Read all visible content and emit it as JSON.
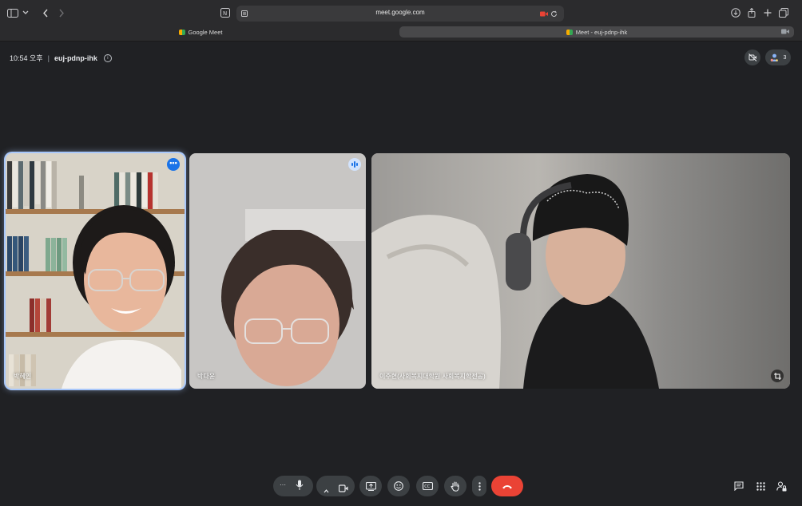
{
  "browser": {
    "url": "meet.google.com",
    "tabs": [
      {
        "label": "Google Meet",
        "active": false
      },
      {
        "label": "Meet - euj-pdnp-ihk",
        "active": true
      }
    ]
  },
  "meeting": {
    "time": "10:54 오후",
    "separator": "|",
    "code": "euj-pdnp-ihk",
    "participant_count": "3"
  },
  "participants": [
    {
      "name": "박혜인",
      "state": "pinned-highlight"
    },
    {
      "name": "박다윤",
      "state": "speaking"
    },
    {
      "name": "이주현(사회복지대학원 사회복지학전공)",
      "state": "normal"
    }
  ],
  "colors": {
    "accent_blue": "#1a73e8",
    "highlight": "#a8c7fa",
    "end_call": "#ea4335",
    "control_bg": "#3c4043"
  },
  "icons": {
    "sidebar": "sidebar-icon",
    "back": "chevron-left-icon",
    "forward": "chevron-right-icon",
    "reader": "reader-icon",
    "camera_active": "camera-recording-icon",
    "reload": "reload-icon",
    "download": "download-icon",
    "share": "share-icon",
    "new_tab": "plus-icon",
    "tab_overview": "tabs-icon",
    "more": "more-horizontal-icon",
    "mic": "mic-icon",
    "camera": "video-camera-icon",
    "present": "present-screen-icon",
    "emoji": "emoji-icon",
    "captions": "captions-icon",
    "raise_hand": "hand-icon",
    "more_vert": "more-vertical-icon",
    "end_call": "call-end-icon",
    "chat": "chat-icon",
    "activities": "apps-grid-icon",
    "host_controls": "lock-person-icon"
  }
}
